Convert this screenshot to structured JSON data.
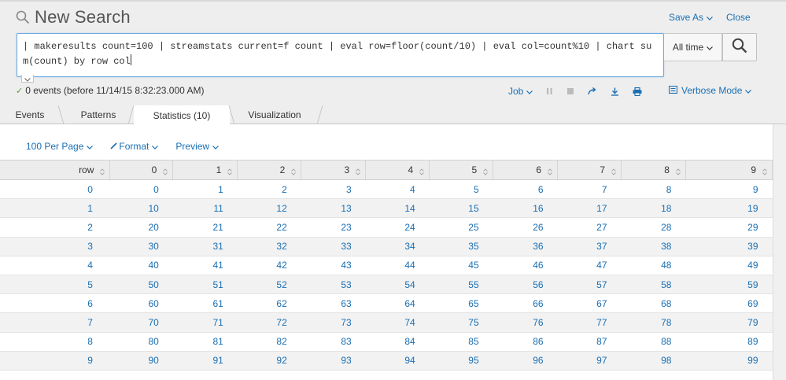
{
  "header": {
    "title": "New Search",
    "save_as": "Save As",
    "close": "Close"
  },
  "search": {
    "query": "| makeresults count=100 | streamstats current=f count | eval row=floor(count/10) | eval col=count%10 | chart sum(count) by row col",
    "time_range": "All time"
  },
  "status": {
    "text": "0 events (before 11/14/15 8:32:23.000 AM)",
    "job": "Job",
    "mode": "Verbose Mode"
  },
  "tabs": [
    {
      "label": "Events"
    },
    {
      "label": "Patterns"
    },
    {
      "label": "Statistics (10)",
      "active": true
    },
    {
      "label": "Visualization"
    }
  ],
  "options": {
    "per_page": "100 Per Page",
    "format": "Format",
    "preview": "Preview"
  },
  "table": {
    "columns": [
      "row",
      "0",
      "1",
      "2",
      "3",
      "4",
      "5",
      "6",
      "7",
      "8",
      "9"
    ],
    "rows": [
      [
        "0",
        "0",
        "1",
        "2",
        "3",
        "4",
        "5",
        "6",
        "7",
        "8",
        "9"
      ],
      [
        "1",
        "10",
        "11",
        "12",
        "13",
        "14",
        "15",
        "16",
        "17",
        "18",
        "19"
      ],
      [
        "2",
        "20",
        "21",
        "22",
        "23",
        "24",
        "25",
        "26",
        "27",
        "28",
        "29"
      ],
      [
        "3",
        "30",
        "31",
        "32",
        "33",
        "34",
        "35",
        "36",
        "37",
        "38",
        "39"
      ],
      [
        "4",
        "40",
        "41",
        "42",
        "43",
        "44",
        "45",
        "46",
        "47",
        "48",
        "49"
      ],
      [
        "5",
        "50",
        "51",
        "52",
        "53",
        "54",
        "55",
        "56",
        "57",
        "58",
        "59"
      ],
      [
        "6",
        "60",
        "61",
        "62",
        "63",
        "64",
        "65",
        "66",
        "67",
        "68",
        "69"
      ],
      [
        "7",
        "70",
        "71",
        "72",
        "73",
        "74",
        "75",
        "76",
        "77",
        "78",
        "79"
      ],
      [
        "8",
        "80",
        "81",
        "82",
        "83",
        "84",
        "85",
        "86",
        "87",
        "88",
        "89"
      ],
      [
        "9",
        "90",
        "91",
        "92",
        "93",
        "94",
        "95",
        "96",
        "97",
        "98",
        "99"
      ]
    ]
  },
  "colors": {
    "link": "#1a6fb3",
    "success": "#5a9e3a"
  },
  "icons": [
    "search-icon",
    "chevron-down-icon",
    "pause-icon",
    "stop-icon",
    "share-icon",
    "export-icon",
    "print-icon",
    "mode-icon",
    "sort-icon",
    "check-icon"
  ]
}
